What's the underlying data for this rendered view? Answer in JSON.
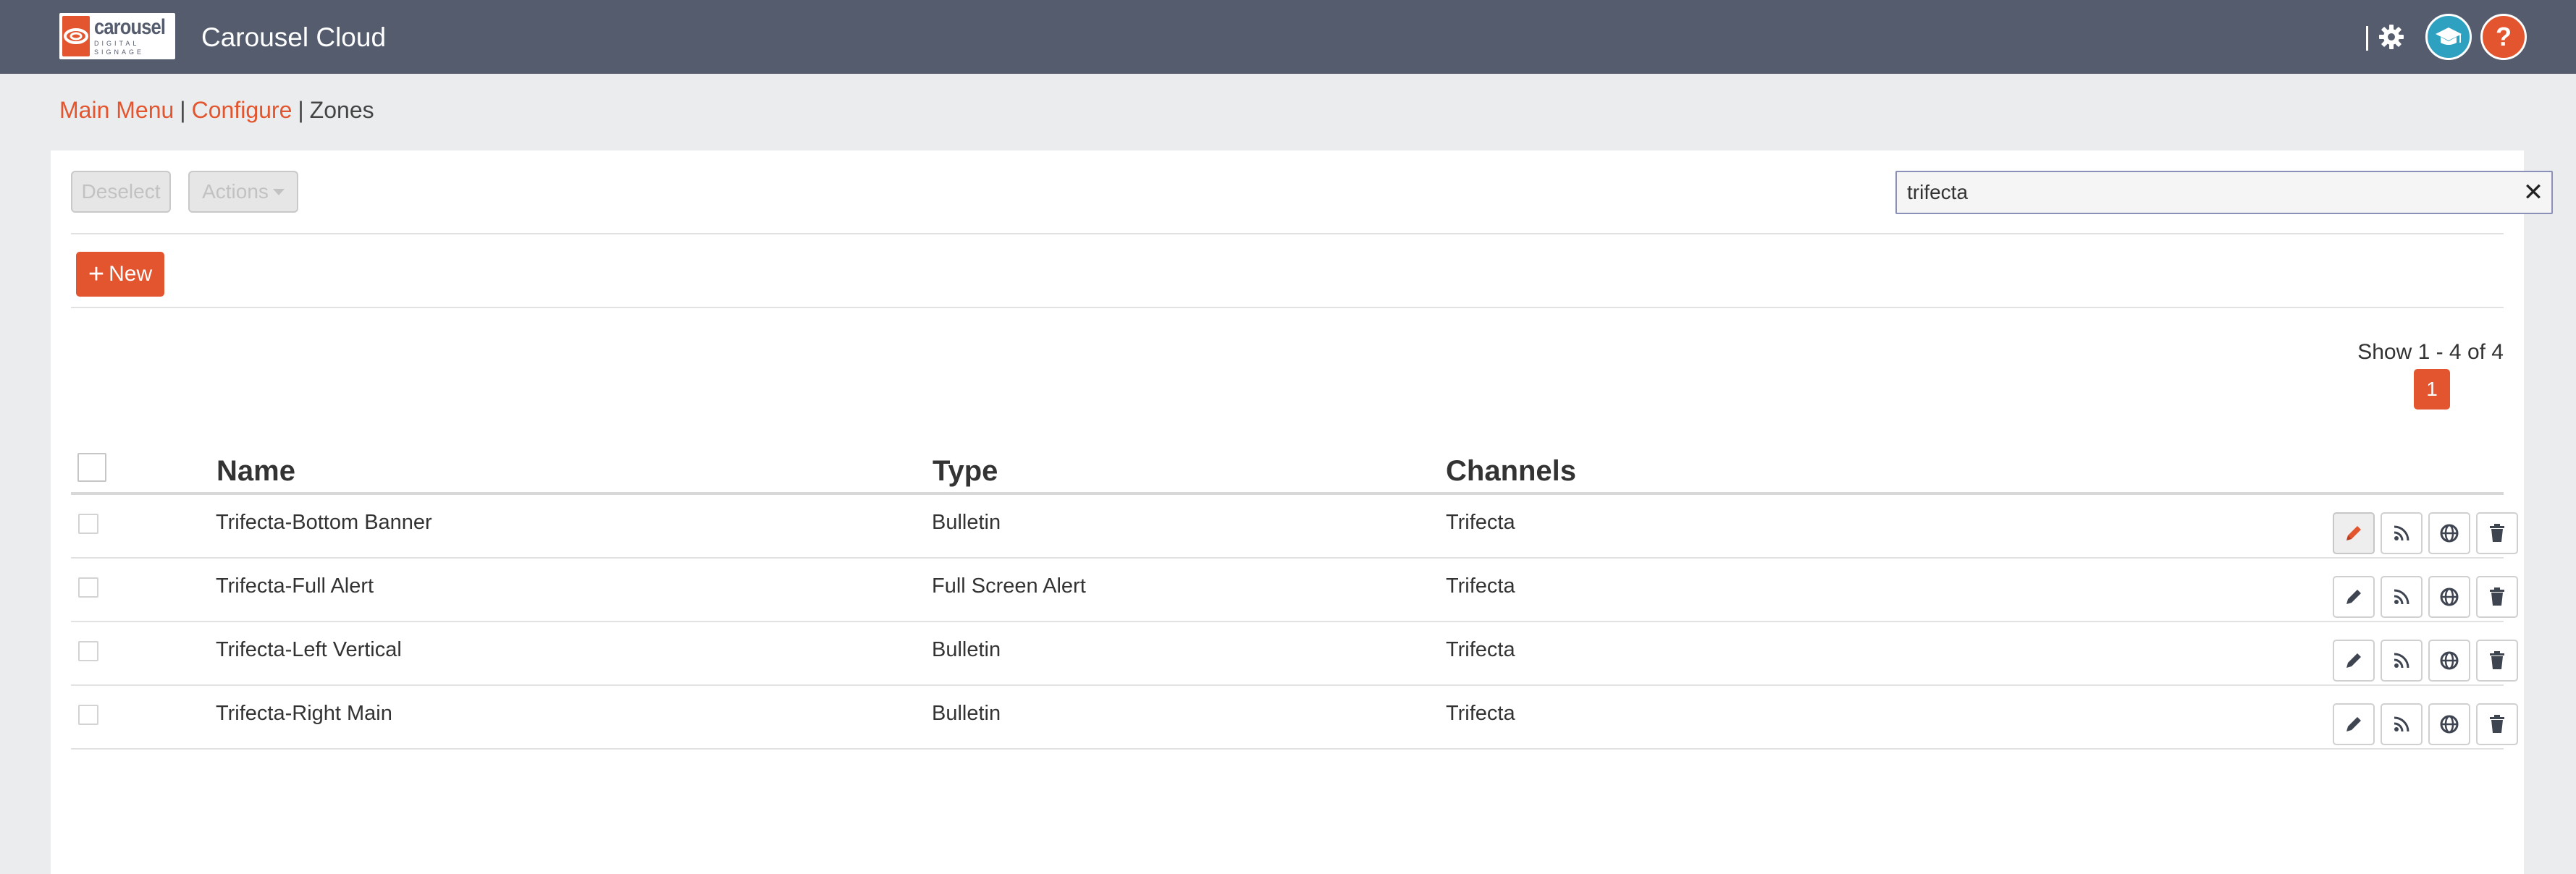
{
  "header": {
    "logo_word": "carousel",
    "logo_sub": "DIGITAL SIGNAGE",
    "app_title": "Carousel Cloud",
    "help_label": "?"
  },
  "breadcrumb": {
    "main_menu": "Main Menu",
    "configure": "Configure",
    "current": "Zones",
    "separator": "|"
  },
  "toolbar": {
    "deselect_label": "Deselect",
    "actions_label": "Actions",
    "search_value": "trifecta",
    "clear_label": "✕",
    "new_label": "New"
  },
  "pagination": {
    "summary": "Show 1 - 4 of 4",
    "current_page": "1"
  },
  "table": {
    "columns": {
      "name": "Name",
      "type": "Type",
      "channels": "Channels"
    },
    "rows": [
      {
        "name": "Trifecta-Bottom Banner",
        "type": "Bulletin",
        "channels": "Trifecta"
      },
      {
        "name": "Trifecta-Full Alert",
        "type": "Full Screen Alert",
        "channels": "Trifecta"
      },
      {
        "name": "Trifecta-Left Vertical",
        "type": "Bulletin",
        "channels": "Trifecta"
      },
      {
        "name": "Trifecta-Right Main",
        "type": "Bulletin",
        "channels": "Trifecta"
      }
    ]
  },
  "colors": {
    "header_bg": "#545c6e",
    "accent": "#e3552f",
    "education": "#2fa1c0"
  },
  "icons": [
    "carousel-logo-icon",
    "gear-icon",
    "graduation-cap-icon",
    "help-icon",
    "close-icon",
    "plus-icon",
    "pencil-icon",
    "rss-icon",
    "globe-icon",
    "trash-icon"
  ]
}
